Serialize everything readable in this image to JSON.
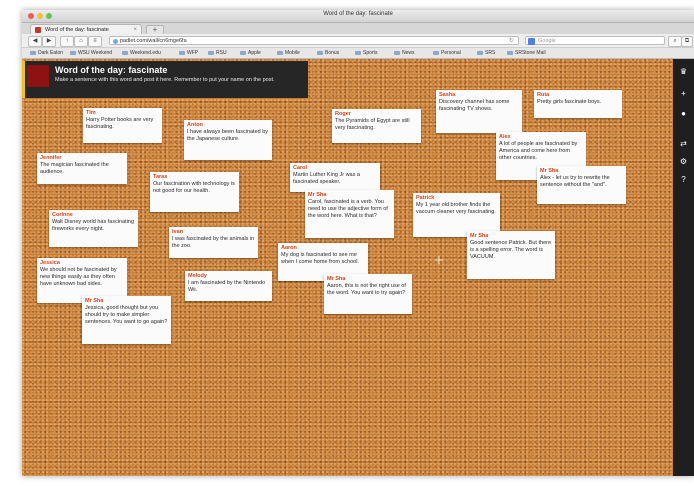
{
  "window": {
    "title": "Word of the day: fascinate"
  },
  "tab": {
    "label": "Word of the day: fascinate"
  },
  "toolbar": {
    "url": "padlet.com/wall/cn6mge6fa",
    "search_placeholder": "Google"
  },
  "bookmarks": [
    "Dark Eaton",
    "WSU Weekend",
    "Weekend.edu",
    "WFP",
    "RSU",
    "Apple",
    "Mobile",
    "Bonus",
    "Sports",
    "News",
    "Personal",
    "SRS",
    "SRStone Mail"
  ],
  "header": {
    "title": "Word of the day: fascinate",
    "description": "Make a sentence with this word and post it here. Remember to put your name on the post."
  },
  "notes": [
    {
      "name": "Tim",
      "text": "Harry Potter books are very fascinating."
    },
    {
      "name": "Anton",
      "text": "I have always been fascinated by the Japanese culture."
    },
    {
      "name": "Roger",
      "text": "The Pyramids of Egypt are still very fascinating."
    },
    {
      "name": "Sasha",
      "text": "Discovery channel has some fascinating TV shows."
    },
    {
      "name": "Ruta",
      "text": "Pretty girls fascinate boys."
    },
    {
      "name": "Jennifer",
      "text": "The magician fascinated the audience."
    },
    {
      "name": "Taras",
      "text": "Our fascination with technology is not good for our health."
    },
    {
      "name": "Carol",
      "text": "Martin Luther King Jr was a fascinated speaker."
    },
    {
      "name": "Mr Sha",
      "text": "Carol, fascinated is a verb. You need to use the adjective form of the word here. What is that?"
    },
    {
      "name": "Alex",
      "text": "A lot of people are fascinated by America and come here from other countries."
    },
    {
      "name": "Mr Sha",
      "text": "Alex - let us try to rewrite the sentence without the \"and\"."
    },
    {
      "name": "Corinne",
      "text": "Walt Disney world has fascinating fireworks every night."
    },
    {
      "name": "Ivan",
      "text": "I was fascinated by the animals in the zoo."
    },
    {
      "name": "Patrick",
      "text": "My 1 year old brother finds the vaccum cleaner very fascinating."
    },
    {
      "name": "Mr Sha",
      "text": "Good sentence Patrick. But there is a spelling error. The word is VACUUM."
    },
    {
      "name": "Jessica",
      "text": "We should not be fascinated by new things easily as they often have unknown bad sides."
    },
    {
      "name": "Melody",
      "text": "I am fascinated by the Nintendo Wii."
    },
    {
      "name": "Aaron",
      "text": "My dog is fascinated to see me when I come home from school."
    },
    {
      "name": "Mr Sha",
      "text": "Aaron, this is not the right use of the word. You want to try again?"
    },
    {
      "name": "Mr Sha",
      "text": "Jessica, good thought but you should try to make simpler sentences. You want to go again?"
    }
  ],
  "colors": {
    "board": "#c77a32",
    "header": "#262626",
    "accent": "#f1c40f",
    "name": "#d5451b",
    "sidebar": "#1f1f1f"
  }
}
